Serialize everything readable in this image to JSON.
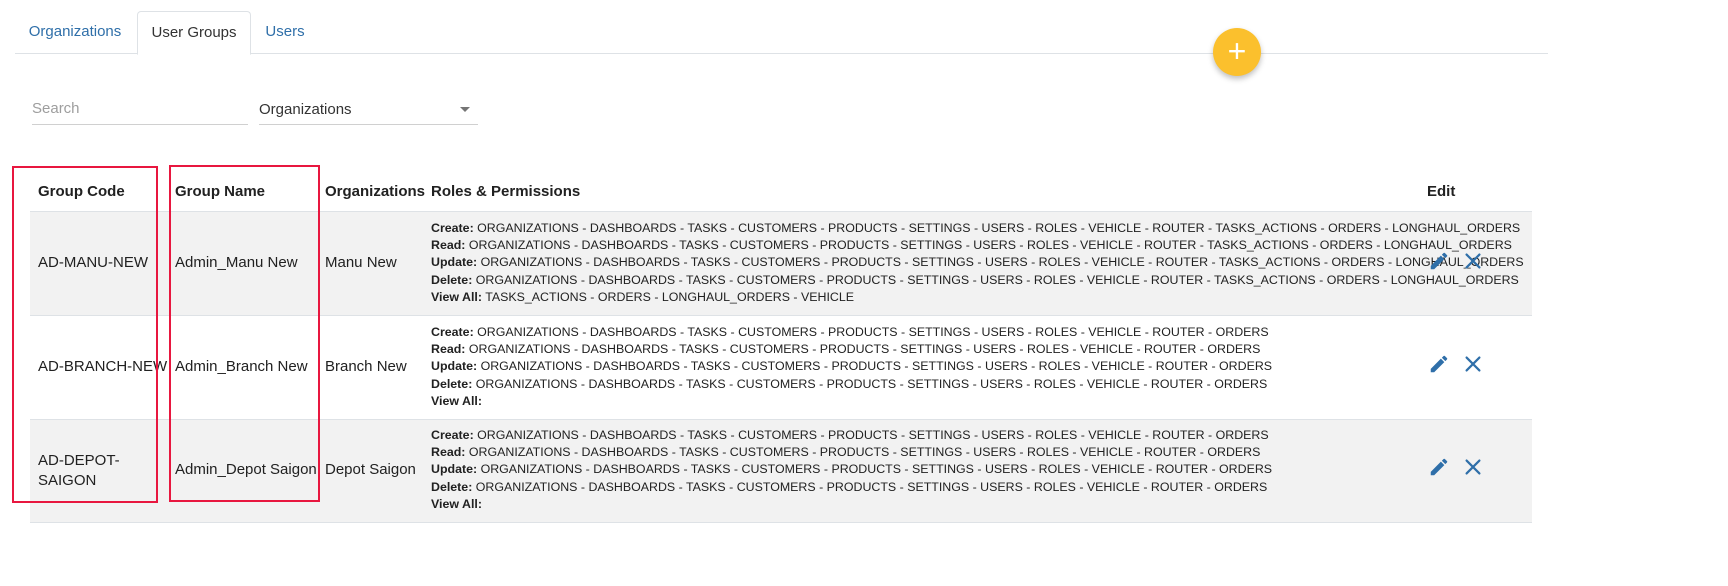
{
  "tabs": [
    {
      "label": "Organizations",
      "active": false
    },
    {
      "label": "User Groups",
      "active": true
    },
    {
      "label": "Users",
      "active": false
    }
  ],
  "fab": {
    "icon": "plus-icon",
    "symbol": "+",
    "color": "#fbc02d"
  },
  "search": {
    "placeholder": "Search",
    "value": ""
  },
  "filter": {
    "selected": "Organizations"
  },
  "table": {
    "headers": [
      "Group Code",
      "Group Name",
      "Organizations",
      "Roles & Permissions",
      "Edit"
    ],
    "rows": [
      {
        "code": "AD-MANU-NEW",
        "name": "Admin_Manu New",
        "org": "Manu New",
        "perms": [
          {
            "label": "Create:",
            "value": "ORGANIZATIONS - DASHBOARDS - TASKS - CUSTOMERS - PRODUCTS - SETTINGS - USERS - ROLES - VEHICLE - ROUTER - TASKS_ACTIONS - ORDERS - LONGHAUL_ORDERS"
          },
          {
            "label": "Read:",
            "value": "ORGANIZATIONS - DASHBOARDS - TASKS - CUSTOMERS - PRODUCTS - SETTINGS - USERS - ROLES - VEHICLE - ROUTER - TASKS_ACTIONS - ORDERS - LONGHAUL_ORDERS"
          },
          {
            "label": "Update:",
            "value": "ORGANIZATIONS - DASHBOARDS - TASKS - CUSTOMERS - PRODUCTS - SETTINGS - USERS - ROLES - VEHICLE - ROUTER - TASKS_ACTIONS - ORDERS - LONGHAUL_ORDERS"
          },
          {
            "label": "Delete:",
            "value": "ORGANIZATIONS - DASHBOARDS - TASKS - CUSTOMERS - PRODUCTS - SETTINGS - USERS - ROLES - VEHICLE - ROUTER - TASKS_ACTIONS - ORDERS - LONGHAUL_ORDERS"
          },
          {
            "label": "View All:",
            "value": "TASKS_ACTIONS - ORDERS - LONGHAUL_ORDERS - VEHICLE"
          }
        ]
      },
      {
        "code": "AD-BRANCH-NEW",
        "name": "Admin_Branch New",
        "org": "Branch New",
        "perms": [
          {
            "label": "Create:",
            "value": "ORGANIZATIONS - DASHBOARDS - TASKS - CUSTOMERS - PRODUCTS - SETTINGS - USERS - ROLES - VEHICLE - ROUTER - ORDERS"
          },
          {
            "label": "Read:",
            "value": "ORGANIZATIONS - DASHBOARDS - TASKS - CUSTOMERS - PRODUCTS - SETTINGS - USERS - ROLES - VEHICLE - ROUTER - ORDERS"
          },
          {
            "label": "Update:",
            "value": "ORGANIZATIONS - DASHBOARDS - TASKS - CUSTOMERS - PRODUCTS - SETTINGS - USERS - ROLES - VEHICLE - ROUTER - ORDERS"
          },
          {
            "label": "Delete:",
            "value": "ORGANIZATIONS - DASHBOARDS - TASKS - CUSTOMERS - PRODUCTS - SETTINGS - USERS - ROLES - VEHICLE - ROUTER - ORDERS"
          },
          {
            "label": "View All:",
            "value": ""
          }
        ]
      },
      {
        "code_line1": "AD-DEPOT-",
        "code_line2": "SAIGON",
        "name": "Admin_Depot Saigon",
        "org": "Depot Saigon",
        "perms": [
          {
            "label": "Create:",
            "value": "ORGANIZATIONS - DASHBOARDS - TASKS - CUSTOMERS - PRODUCTS - SETTINGS - USERS - ROLES - VEHICLE - ROUTER - ORDERS"
          },
          {
            "label": "Read:",
            "value": "ORGANIZATIONS - DASHBOARDS - TASKS - CUSTOMERS - PRODUCTS - SETTINGS - USERS - ROLES - VEHICLE - ROUTER - ORDERS"
          },
          {
            "label": "Update:",
            "value": "ORGANIZATIONS - DASHBOARDS - TASKS - CUSTOMERS - PRODUCTS - SETTINGS - USERS - ROLES - VEHICLE - ROUTER - ORDERS"
          },
          {
            "label": "Delete:",
            "value": "ORGANIZATIONS - DASHBOARDS - TASKS - CUSTOMERS - PRODUCTS - SETTINGS - USERS - ROLES - VEHICLE - ROUTER - ORDERS"
          },
          {
            "label": "View All:",
            "value": ""
          }
        ]
      }
    ]
  },
  "colors": {
    "link": "#2f6fa9",
    "icon": "#2f6fa9",
    "highlight": "#e8173f",
    "fab": "#fbc02d"
  }
}
